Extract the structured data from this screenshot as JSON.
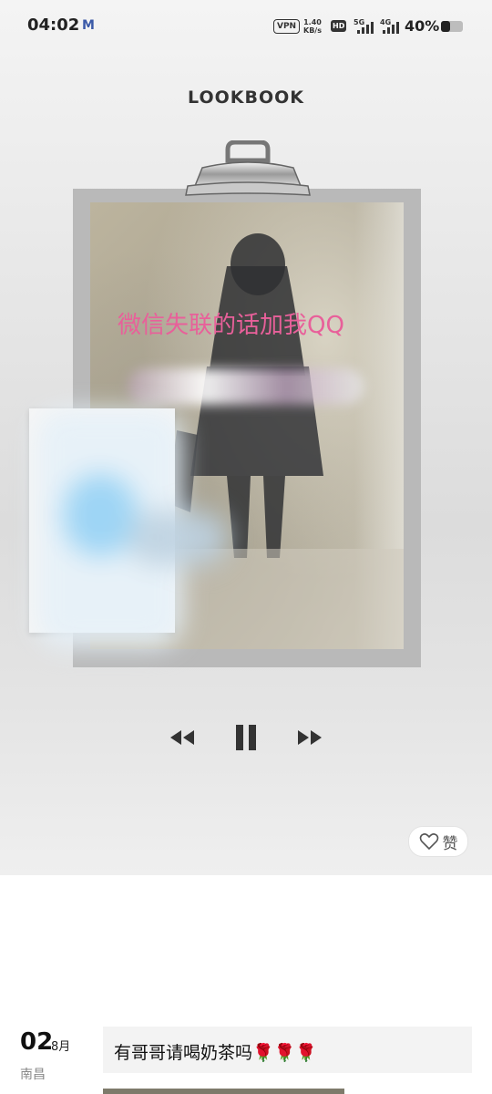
{
  "status_bar": {
    "time": "04:02",
    "app_badge": "M",
    "vpn": "VPN",
    "speed_value": "1.40",
    "speed_unit": "KB/s",
    "hd_label": "HD",
    "net_5g": "5G",
    "net_4g": "4G",
    "battery": "40%",
    "battery_level": 0.4
  },
  "header": {
    "title": "LOOKBOOK"
  },
  "photo": {
    "caption": "微信失联的话加我QQ"
  },
  "like": {
    "label": "赞"
  },
  "post": {
    "day": "02",
    "month": "8月",
    "location": "南昌",
    "text": "有哥哥请喝奶茶吗🌹🌹🌹"
  }
}
